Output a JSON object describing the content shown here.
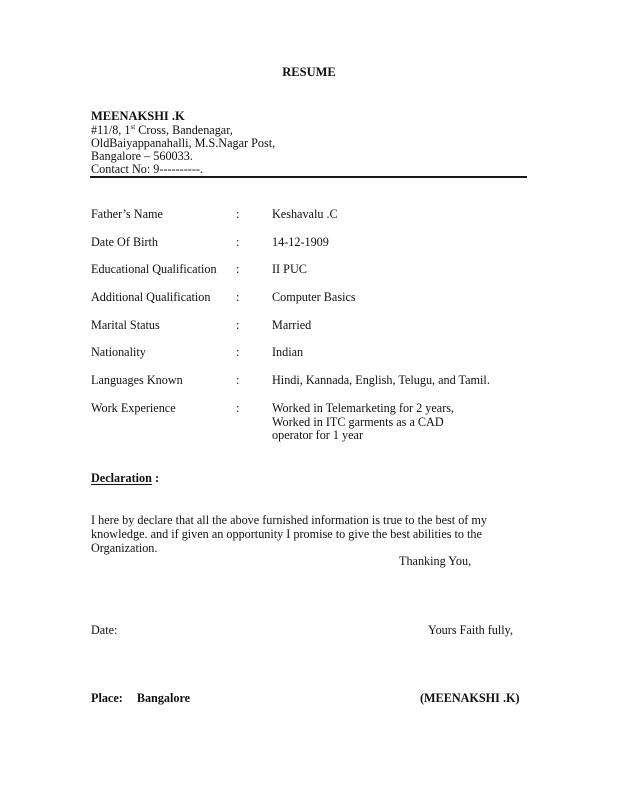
{
  "document": {
    "title": "RESUME",
    "header": {
      "name": "MEENAKSHI .K",
      "address_line1_pre": "#11/8, 1",
      "address_line1_sup": "st",
      "address_line1_post": " Cross, Bandenagar,",
      "address_line2": "OldBaiyappanahalli, M.S.Nagar Post,",
      "address_line3": "Bangalore – 560033.",
      "contact": "Contact No: 9----------."
    },
    "details": [
      {
        "label": "Father’s Name",
        "sep": ":",
        "value": [
          "Keshavalu .C"
        ]
      },
      {
        "label": "Date Of  Birth",
        "sep": ":",
        "value": [
          "14-12-1909"
        ]
      },
      {
        "label": "Educational Qualification",
        "sep": ":",
        "value": [
          "II PUC"
        ]
      },
      {
        "label": "Additional Qualification",
        "sep": ":",
        "value": [
          "Computer Basics"
        ]
      },
      {
        "label": "Marital Status",
        "sep": ":",
        "value": [
          "Married"
        ]
      },
      {
        "label": "Nationality",
        "sep": ":",
        "value": [
          "Indian"
        ]
      },
      {
        "label": "Languages Known",
        "sep": ":",
        "value": [
          "Hindi, Kannada, English, Telugu, and Tamil."
        ]
      },
      {
        "label": "Work Experience",
        "sep": ":",
        "value": [
          "Worked in Telemarketing for 2 years,",
          "Worked in ITC garments as a CAD",
          "operator for 1 year"
        ]
      }
    ],
    "declaration": {
      "heading": "Declaration",
      "heading_suffix": " :",
      "lines": [
        "I here by declare that all the above furnished information is true to the best of my",
        "knowledge. and if given an opportunity I promise to give the best abilities to the",
        "Organization."
      ],
      "thanks": "Thanking You,"
    },
    "footer": {
      "date_label": "Date:",
      "closing": "Yours Faith fully,",
      "place_label": "Place:",
      "place_value": "Bangalore",
      "signature": "(MEENAKSHI .K)"
    }
  }
}
